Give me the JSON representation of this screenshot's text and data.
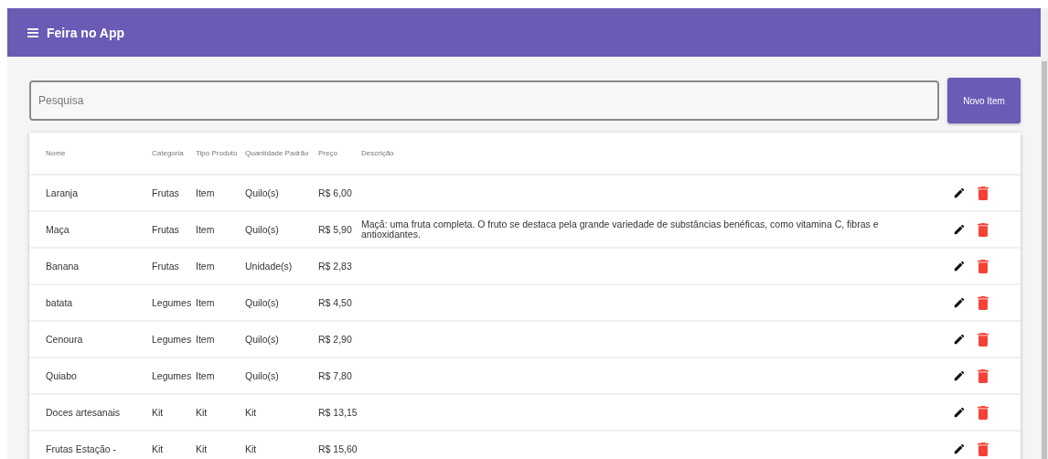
{
  "app_bar": {
    "title": "Feira no App"
  },
  "search": {
    "placeholder": "Pesquisa"
  },
  "new_button": {
    "label": "Novo Item"
  },
  "table": {
    "columns": [
      {
        "label": "Nome"
      },
      {
        "label": "Categoria"
      },
      {
        "label": "Tipo Produto"
      },
      {
        "label": "Quantidade Padrão"
      },
      {
        "label": "Preço"
      },
      {
        "label": "Descrição"
      }
    ],
    "rows": [
      {
        "cells": [
          "Laranja",
          "Frutas",
          "Item",
          "Quilo(s)",
          "R$ 6,00",
          ""
        ]
      },
      {
        "cells": [
          "Maça",
          "Frutas",
          "Item",
          "Quilo(s)",
          "R$ 5,90",
          "Maçã: uma fruta completa. O fruto se destaca pela grande variedade de substâncias benéficas, como vitamina C, fibras e antioxidantes."
        ]
      },
      {
        "cells": [
          "Banana",
          "Frutas",
          "Item",
          "Unidade(s)",
          "R$ 2,83",
          ""
        ]
      },
      {
        "cells": [
          "batata",
          "Legumes",
          "Item",
          "Quilo(s)",
          "R$ 4,50",
          ""
        ]
      },
      {
        "cells": [
          "Cenoura",
          "Legumes",
          "Item",
          "Quilo(s)",
          "R$ 2,90",
          ""
        ]
      },
      {
        "cells": [
          "Quiabo",
          "Legumes",
          "Item",
          "Quilo(s)",
          "R$ 7,80",
          ""
        ]
      },
      {
        "cells": [
          "Doces artesanais",
          "Kit",
          "Kit",
          "Kit",
          "R$ 13,15",
          ""
        ]
      },
      {
        "cells": [
          "Frutas Estação -",
          "Kit",
          "Kit",
          "Kit",
          "R$ 15,60",
          ""
        ]
      }
    ]
  }
}
